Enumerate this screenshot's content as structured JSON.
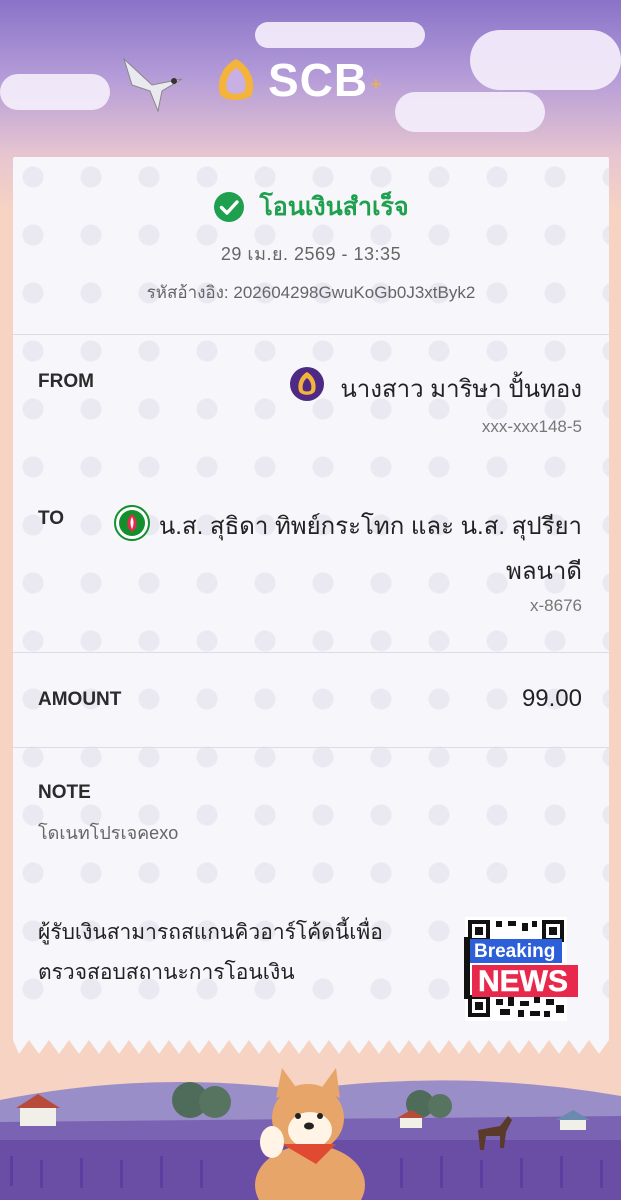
{
  "header": {
    "brand": "SCB",
    "brand_plus": "+"
  },
  "status": {
    "text": "โอนเงินสำเร็จ",
    "datetime": "29 เม.ย. 2569 - 13:35",
    "reference": "รหัสอ้างอิง: 202604298GwuKoGb0J3xtByk2",
    "color": "#1fa04f"
  },
  "from": {
    "label": "FROM",
    "name": "นางสาว มาริษา ปั้นทอง",
    "account": "xxx-xxx148-5",
    "bank_icon": "scb-icon"
  },
  "to": {
    "label": "TO",
    "name_line1": "น.ส. สุธิดา ทิพย์กระโทก และ น.ส. สุปรียา",
    "name_line2": "พลนาดี",
    "account": "x-8676",
    "bank_icon": "kbank-icon"
  },
  "amount": {
    "label": "AMOUNT",
    "value": "99.00"
  },
  "note": {
    "label": "NOTE",
    "text": "โดเนทโปรเจคexo"
  },
  "qr": {
    "text_line1": "ผู้รับเงินสามารถสแกนคิวอาร์โค้ดนี้เพื่อ",
    "text_line2": "ตรวจสอบสถานะการโอนเงิน",
    "overlay_line1": "Breaking",
    "overlay_line2": "NEWS"
  },
  "colors": {
    "scb_purple": "#4e2a84",
    "scb_gold": "#f4b33a",
    "kbank_green": "#138f2d",
    "breaking_blue": "#2c5fd8",
    "news_red": "#e8294b"
  }
}
